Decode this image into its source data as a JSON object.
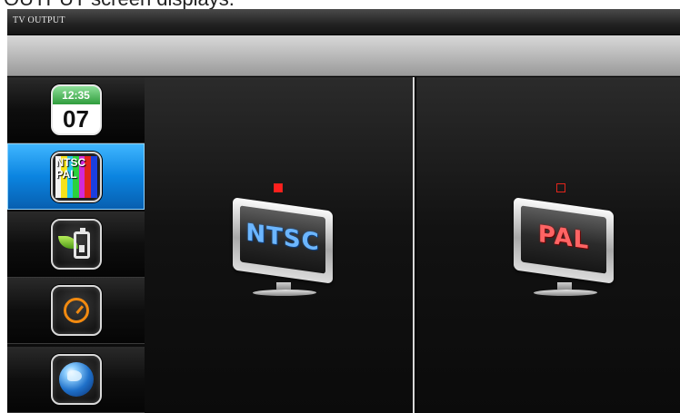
{
  "caption": "OUTPUT screen displays.",
  "window": {
    "title": "TV OUTPUT"
  },
  "sidebar": {
    "items": [
      {
        "key": "date-time",
        "icon": "calendar-clock-icon",
        "time": "12:35",
        "day": "07",
        "active": false
      },
      {
        "key": "tv-output",
        "icon": "ntsc-pal-icon",
        "text_top": "NTSC",
        "text_bottom": "PAL",
        "active": true
      },
      {
        "key": "power-saving",
        "icon": "eco-battery-icon",
        "active": false
      },
      {
        "key": "timer",
        "icon": "timer-icon",
        "active": false
      },
      {
        "key": "language",
        "icon": "globe-icon",
        "active": false
      }
    ]
  },
  "options": [
    {
      "label": "NTSC",
      "icon": "tv-icon",
      "selected": true,
      "label_color": "#6cb6ff"
    },
    {
      "label": "PAL",
      "icon": "tv-icon",
      "selected": false,
      "label_color": "#ff6464"
    }
  ],
  "colors": {
    "accent": "#0b84e0",
    "radio": "#ff1e1e"
  }
}
